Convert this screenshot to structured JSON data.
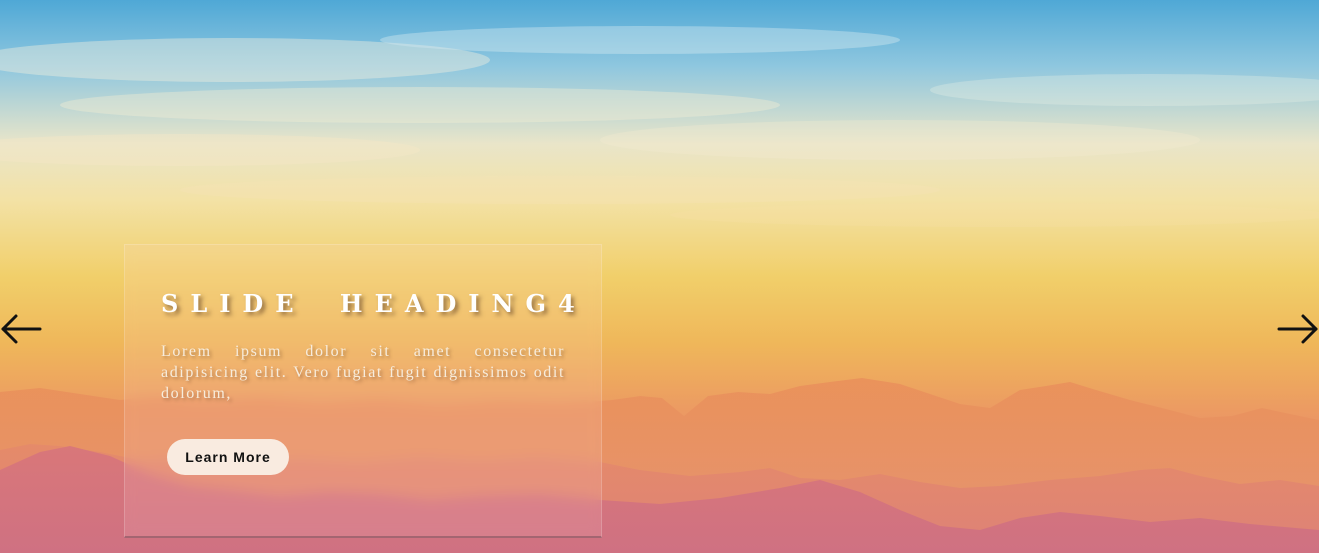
{
  "slide": {
    "heading": "SLIDE HEADING4",
    "text": "Lorem ipsum dolor sit amet consectetur adipisicing elit. Vero fugiat fugit dignissimos odit dolorum,",
    "button_label": "Learn More"
  },
  "navigation": {
    "prev_icon": "arrow-left-icon",
    "next_icon": "arrow-right-icon"
  },
  "colors": {
    "sky_top": "#4fa8d6",
    "sky_mid": "#f1cf6a",
    "sky_bottom": "#d9787e",
    "button_bg": "#f9ebe0",
    "heading": "#ffffff",
    "arrow": "#111111"
  }
}
